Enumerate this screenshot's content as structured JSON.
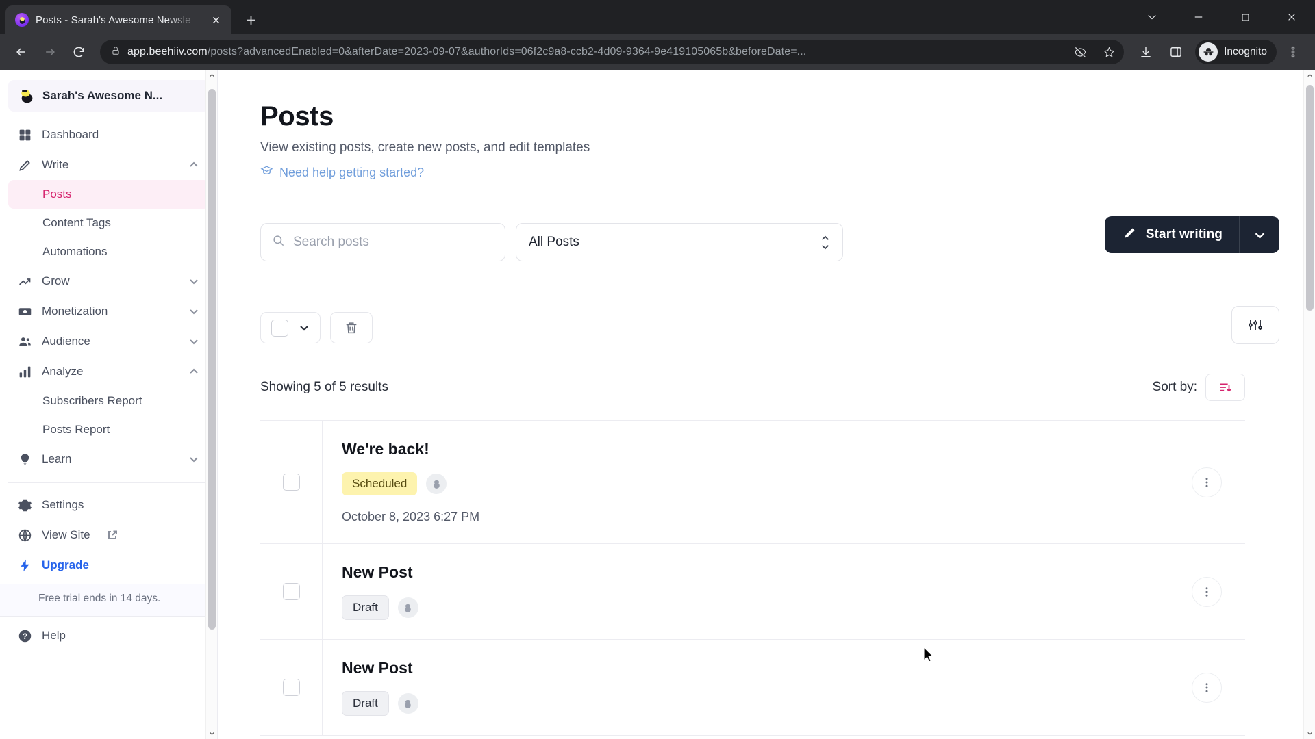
{
  "browser": {
    "tab": {
      "title": "Posts - Sarah's Awesome Newsle",
      "favicon": "beehiiv-icon"
    },
    "new_tab_label": "+",
    "url_host": "app.beehiiv.com",
    "url_path": "/posts?advancedEnabled=0&afterDate=2023-09-07&authorIds=06f2c9a8-ccb2-4d09-9364-9e419105065b&beforeDate=...",
    "profile_label": "Incognito",
    "icons": {
      "back": "back-arrow-icon",
      "forward": "forward-arrow-icon",
      "reload": "reload-icon",
      "lock": "lock-icon",
      "tracking": "eye-off-icon",
      "bookmark": "star-icon",
      "downloads": "download-icon",
      "side_panel": "side-panel-icon",
      "menu": "three-dot-menu-icon",
      "minimize": "minimize-icon",
      "maximize": "maximize-icon",
      "close": "window-close-icon",
      "tab_search": "tab-search-icon"
    }
  },
  "sidebar": {
    "publication": "Sarah's Awesome N...",
    "items": [
      {
        "label": "Dashboard",
        "icon": "grid-icon",
        "expandable": false
      },
      {
        "label": "Write",
        "icon": "pencil-icon",
        "expandable": true,
        "state": "expanded"
      },
      {
        "label": "Grow",
        "icon": "trending-up-icon",
        "expandable": true,
        "state": "collapsed"
      },
      {
        "label": "Monetization",
        "icon": "money-icon",
        "expandable": true,
        "state": "collapsed"
      },
      {
        "label": "Audience",
        "icon": "people-icon",
        "expandable": true,
        "state": "collapsed"
      },
      {
        "label": "Analyze",
        "icon": "bar-chart-icon",
        "expandable": true,
        "state": "expanded"
      },
      {
        "label": "Learn",
        "icon": "lightbulb-icon",
        "expandable": true,
        "state": "collapsed"
      }
    ],
    "write_children": [
      {
        "label": "Posts",
        "active": true
      },
      {
        "label": "Content Tags",
        "active": false
      },
      {
        "label": "Automations",
        "active": false
      }
    ],
    "analyze_children": [
      {
        "label": "Subscribers Report",
        "active": false
      },
      {
        "label": "Posts Report",
        "active": false
      }
    ],
    "footer_items": [
      {
        "label": "Settings",
        "icon": "gear-icon"
      },
      {
        "label": "View Site",
        "icon": "globe-icon",
        "external": true
      },
      {
        "label": "Upgrade",
        "icon": "lightning-icon"
      }
    ],
    "trial_note": "Free trial ends in 14 days.",
    "help_label": "Help"
  },
  "page": {
    "title": "Posts",
    "subtitle": "View existing posts, create new posts, and edit templates",
    "help_link": "Need help getting started?",
    "start_writing_label": "Start writing"
  },
  "toolbar": {
    "search_placeholder": "Search posts",
    "search_value": "",
    "filter_selected": "All Posts",
    "filter_options": [
      "All Posts"
    ],
    "advanced_filter_icon": "sliders-icon",
    "bulk_select_icon": "checkbox-dropdown",
    "delete_icon": "trash-icon"
  },
  "results": {
    "count_text": "Showing 5 of 5 results",
    "sort_label": "Sort by:",
    "sort_icon": "sort-descending-icon"
  },
  "posts": [
    {
      "title": "We're back!",
      "status": "Scheduled",
      "status_type": "scheduled",
      "channel_icon": "email-icon",
      "date": "October 8, 2023 6:27 PM"
    },
    {
      "title": "New Post",
      "status": "Draft",
      "status_type": "draft",
      "channel_icon": "email-icon",
      "date": ""
    },
    {
      "title": "New Post",
      "status": "Draft",
      "status_type": "draft",
      "channel_icon": "email-icon",
      "date": ""
    }
  ],
  "colors": {
    "accent_pink": "#d6246e",
    "active_bg": "#fdeef6",
    "dark_button": "#1c2433",
    "scheduled_badge": "#fdf3ae",
    "link_blue": "#2563eb",
    "help_link_blue": "#6f9ddb"
  }
}
